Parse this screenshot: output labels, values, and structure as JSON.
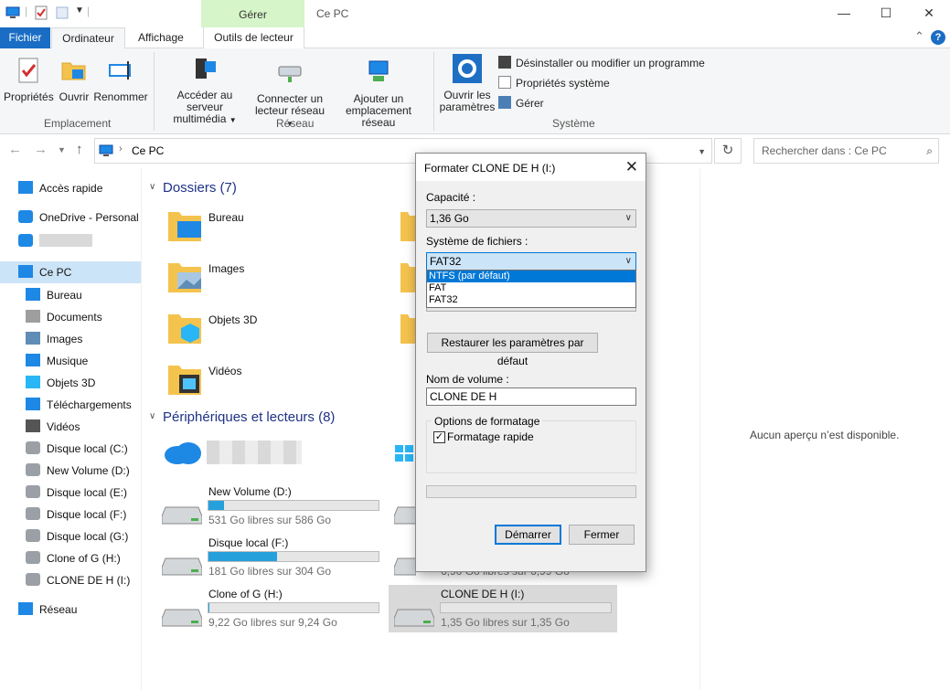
{
  "window": {
    "title": "Ce PC",
    "context_tab": "Gérer",
    "controls": {
      "minimize": "—",
      "maximize": "☐",
      "close": "✕"
    }
  },
  "ribbon_tabs": {
    "fichier": "Fichier",
    "ordinateur": "Ordinateur",
    "affichage": "Affichage",
    "outils": "Outils de lecteur",
    "collapse": "⌃",
    "help": "?"
  },
  "ribbon": {
    "emplacement": {
      "label": "Emplacement",
      "proprietes": "Propriétés",
      "ouvrir": "Ouvrir",
      "renommer": "Renommer"
    },
    "reseau": {
      "label": "Réseau",
      "acceder_line1": "Accéder au serveur",
      "acceder_line2": "multimédia",
      "connecter_line1": "Connecter un",
      "connecter_line2": "lecteur réseau",
      "ajouter_line1": "Ajouter un",
      "ajouter_line2": "emplacement réseau"
    },
    "systeme": {
      "label": "Système",
      "parametres_line1": "Ouvrir les",
      "parametres_line2": "paramètres",
      "desinstaller": "Désinstaller ou modifier un programme",
      "proprietes_systeme": "Propriétés système",
      "gerer": "Gérer"
    }
  },
  "address": {
    "path": "Ce PC",
    "search_placeholder": "Rechercher dans : Ce PC"
  },
  "sidebar": {
    "items": [
      {
        "label": "Accès rapide",
        "icon": "star-icon"
      },
      {
        "label": "OneDrive - Personal",
        "icon": "cloud-icon"
      },
      {
        "label": "",
        "icon": "cloud-icon"
      },
      {
        "label": "Ce PC",
        "icon": "computer-icon",
        "selected": true
      },
      {
        "label": "Bureau",
        "icon": "desktop-icon"
      },
      {
        "label": "Documents",
        "icon": "documents-icon"
      },
      {
        "label": "Images",
        "icon": "images-icon"
      },
      {
        "label": "Musique",
        "icon": "music-icon"
      },
      {
        "label": "Objets 3D",
        "icon": "cube-icon"
      },
      {
        "label": "Téléchargements",
        "icon": "download-icon"
      },
      {
        "label": "Vidéos",
        "icon": "video-icon"
      },
      {
        "label": "Disque local (C:)",
        "icon": "drive-icon"
      },
      {
        "label": "New Volume (D:)",
        "icon": "drive-icon"
      },
      {
        "label": "Disque local (E:)",
        "icon": "drive-icon"
      },
      {
        "label": "Disque local (F:)",
        "icon": "drive-icon"
      },
      {
        "label": "Disque local (G:)",
        "icon": "drive-icon"
      },
      {
        "label": "Clone of G (H:)",
        "icon": "drive-icon"
      },
      {
        "label": "CLONE DE H (I:)",
        "icon": "drive-icon"
      },
      {
        "label": "Réseau",
        "icon": "network-icon"
      }
    ]
  },
  "folders_section": {
    "title": "Dossiers (7)",
    "items": [
      {
        "label": "Bureau"
      },
      {
        "label": "Images"
      },
      {
        "label": "Objets 3D"
      },
      {
        "label": "Vidéos"
      }
    ]
  },
  "devices_section": {
    "title": "Périphériques et lecteurs (8)",
    "drives": [
      {
        "name": "New Volume (D:)",
        "free": "531 Go libres sur 586 Go",
        "used_fraction": 0.094
      },
      {
        "name": "Disque local (F:)",
        "free": "181 Go libres sur 304 Go",
        "used_fraction": 0.405
      },
      {
        "name": "Clone of G (H:)",
        "free": "9,22 Go libres sur 9,24 Go",
        "used_fraction": 0.002
      },
      {
        "name": "",
        "free": "6,90 Go libres sur 6,99 Go",
        "used_fraction": 0.013
      },
      {
        "name": "CLONE DE H (I:)",
        "free": "1,35 Go libres sur 1,35 Go",
        "used_fraction": 0.0
      }
    ]
  },
  "preview": {
    "text": "Aucun aperçu n’est disponible."
  },
  "dialog": {
    "title": "Formater CLONE DE H (I:)",
    "close": "✕",
    "capacite_label": "Capacité :",
    "capacite_value": "1,36 Go",
    "fs_label": "Système de fichiers :",
    "fs_value": "FAT32",
    "fs_options": [
      "NTFS (par défaut)",
      "FAT",
      "FAT32"
    ],
    "restore_button": "Restaurer les paramètres par défaut",
    "volume_label": "Nom de volume :",
    "volume_value": "CLONE DE H",
    "options_label": "Options de formatage",
    "quick_format": "Formatage rapide",
    "quick_format_checked": true,
    "start_button": "Démarrer",
    "close_button": "Fermer"
  }
}
